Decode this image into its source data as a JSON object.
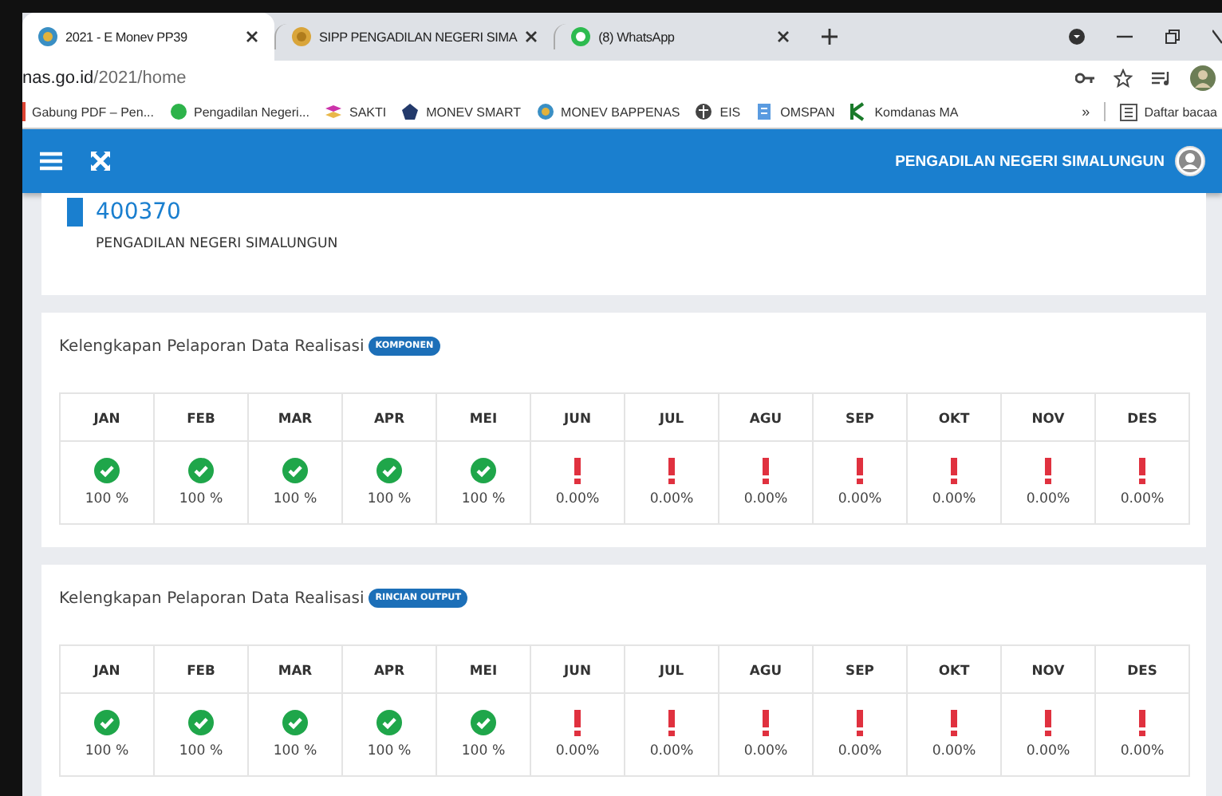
{
  "browser": {
    "tabs": [
      {
        "title": "2021 - E Monev PP39",
        "selected": true
      },
      {
        "title": "SIPP PENGADILAN NEGERI SIMA",
        "selected": false
      },
      {
        "title": "(8) WhatsApp",
        "selected": false
      }
    ],
    "address": {
      "host": "nas.go.id",
      "path": "/2021/home"
    },
    "bookmarks": [
      "Gabung PDF – Pen...",
      "Pengadilan Negeri...",
      "SAKTI",
      "MONEV SMART",
      "MONEV BAPPENAS",
      "EIS",
      "OMSPAN",
      "Komdanas MA"
    ],
    "more": "»",
    "reading_list": "Daftar bacaa"
  },
  "header": {
    "user": "PENGADILAN NEGERI SIMALUNGUN"
  },
  "unit": {
    "code": "400370",
    "name": "PENGADILAN NEGERI SIMALUNGUN"
  },
  "sections": [
    {
      "title": "Kelengkapan Pelaporan Data Realisasi",
      "badge": "KOMPONEN",
      "months": [
        {
          "label": "JAN",
          "kind": "ok",
          "value": "100 %"
        },
        {
          "label": "FEB",
          "kind": "ok",
          "value": "100 %"
        },
        {
          "label": "MAR",
          "kind": "ok",
          "value": "100 %"
        },
        {
          "label": "APR",
          "kind": "ok",
          "value": "100 %"
        },
        {
          "label": "MEI",
          "kind": "ok",
          "value": "100 %"
        },
        {
          "label": "JUN",
          "kind": "warn",
          "value": "0.00%"
        },
        {
          "label": "JUL",
          "kind": "warn",
          "value": "0.00%"
        },
        {
          "label": "AGU",
          "kind": "warn",
          "value": "0.00%"
        },
        {
          "label": "SEP",
          "kind": "warn",
          "value": "0.00%"
        },
        {
          "label": "OKT",
          "kind": "warn",
          "value": "0.00%"
        },
        {
          "label": "NOV",
          "kind": "warn",
          "value": "0.00%"
        },
        {
          "label": "DES",
          "kind": "warn",
          "value": "0.00%"
        }
      ]
    },
    {
      "title": "Kelengkapan Pelaporan Data Realisasi",
      "badge": "RINCIAN OUTPUT",
      "months": [
        {
          "label": "JAN",
          "kind": "ok",
          "value": "100 %"
        },
        {
          "label": "FEB",
          "kind": "ok",
          "value": "100 %"
        },
        {
          "label": "MAR",
          "kind": "ok",
          "value": "100 %"
        },
        {
          "label": "APR",
          "kind": "ok",
          "value": "100 %"
        },
        {
          "label": "MEI",
          "kind": "ok",
          "value": "100 %"
        },
        {
          "label": "JUN",
          "kind": "warn",
          "value": "0.00%"
        },
        {
          "label": "JUL",
          "kind": "warn",
          "value": "0.00%"
        },
        {
          "label": "AGU",
          "kind": "warn",
          "value": "0.00%"
        },
        {
          "label": "SEP",
          "kind": "warn",
          "value": "0.00%"
        },
        {
          "label": "OKT",
          "kind": "warn",
          "value": "0.00%"
        },
        {
          "label": "NOV",
          "kind": "warn",
          "value": "0.00%"
        },
        {
          "label": "DES",
          "kind": "warn",
          "value": "0.00%"
        }
      ]
    }
  ]
}
